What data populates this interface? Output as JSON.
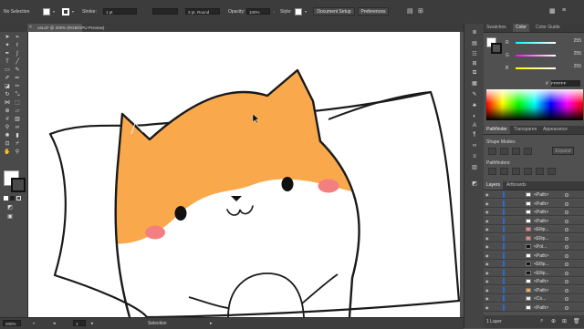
{
  "control_bar": {
    "selection": "No Selection",
    "stroke_label": "Stroke:",
    "stroke_value": "1 pt",
    "brush_value": "3 pt. Round",
    "opacity_label": "Opacity:",
    "opacity_value": "100%",
    "style_label": "Style:",
    "document_setup": "Document Setup",
    "preferences": "Preferences"
  },
  "tab": {
    "title": "cat.ai* @ 200% (RGB/GPU Preview)",
    "close": "×"
  },
  "status_bar": {
    "zoom": "200%",
    "artboard_number": "1",
    "tool": "Selection"
  },
  "color_panel": {
    "tabs": [
      "Swatches",
      "Color",
      "Color Guide"
    ],
    "channels": [
      {
        "label": "R",
        "value": "255"
      },
      {
        "label": "G",
        "value": "255"
      },
      {
        "label": "B",
        "value": "255"
      }
    ],
    "hex": "FFFFFF"
  },
  "pathfinder_panel": {
    "tabs": [
      "Pathfinder",
      "Transparen",
      "Appearance"
    ],
    "shape_modes_label": "Shape Modes:",
    "expand_label": "Expand",
    "pathfinders_label": "Pathfinders:"
  },
  "layers_panel": {
    "tabs": [
      "Layers",
      "Artboards"
    ],
    "rows": [
      {
        "name": "<Path>",
        "thumb": "path"
      },
      {
        "name": "<Path>",
        "thumb": "path"
      },
      {
        "name": "<Path>",
        "thumb": "path"
      },
      {
        "name": "<Path>",
        "thumb": "path"
      },
      {
        "name": "<Ellip...",
        "thumb": "ellipse-pink"
      },
      {
        "name": "<Ellip...",
        "thumb": "ellipse-pink"
      },
      {
        "name": "<Pol...",
        "thumb": "polygon-black"
      },
      {
        "name": "<Path>",
        "thumb": "path"
      },
      {
        "name": "<Ellip...",
        "thumb": "ellipse-black"
      },
      {
        "name": "<Ellip...",
        "thumb": "ellipse-black"
      },
      {
        "name": "<Path>",
        "thumb": "path"
      },
      {
        "name": "<Path>",
        "thumb": "path-orange"
      },
      {
        "name": "<Co...",
        "thumb": "compound"
      },
      {
        "name": "<Path>",
        "thumb": "path"
      }
    ],
    "footer": "1 Layer"
  },
  "colors": {
    "fur_orange": "#f9a94c",
    "cheek_pink": "#f47f81",
    "ui_dark": "#3c3c3c",
    "ui_mid": "#535353",
    "selection_blue": "#2e6ad4"
  },
  "icons": {
    "tools": [
      "selection-arrow-icon",
      "direct-selection-icon",
      "magic-wand-icon",
      "lasso-icon",
      "pen-icon",
      "curvature-icon",
      "type-icon",
      "line-icon",
      "rectangle-icon",
      "paintbrush-icon",
      "shaper-icon",
      "pencil-icon",
      "eraser-icon",
      "scissors-icon",
      "rotate-icon",
      "scale-icon",
      "width-icon",
      "free-transform-icon",
      "shape-builder-icon",
      "perspective-icon",
      "mesh-icon",
      "gradient-icon",
      "eyedropper-icon",
      "blend-icon",
      "symbol-sprayer-icon",
      "column-graph-icon",
      "artboard-icon",
      "slice-icon",
      "hand-icon",
      "zoom-icon"
    ],
    "panel_strip": [
      "layers-icon",
      "libraries-icon",
      "properties-icon",
      "align-icon",
      "transform-icon",
      "swatches-icon",
      "brushes-icon",
      "symbols-icon",
      "graphic-styles-icon",
      "character-icon",
      "paragraph-icon",
      "links-icon",
      "stroke-icon",
      "gradient-icon",
      "image-trace-icon"
    ]
  }
}
